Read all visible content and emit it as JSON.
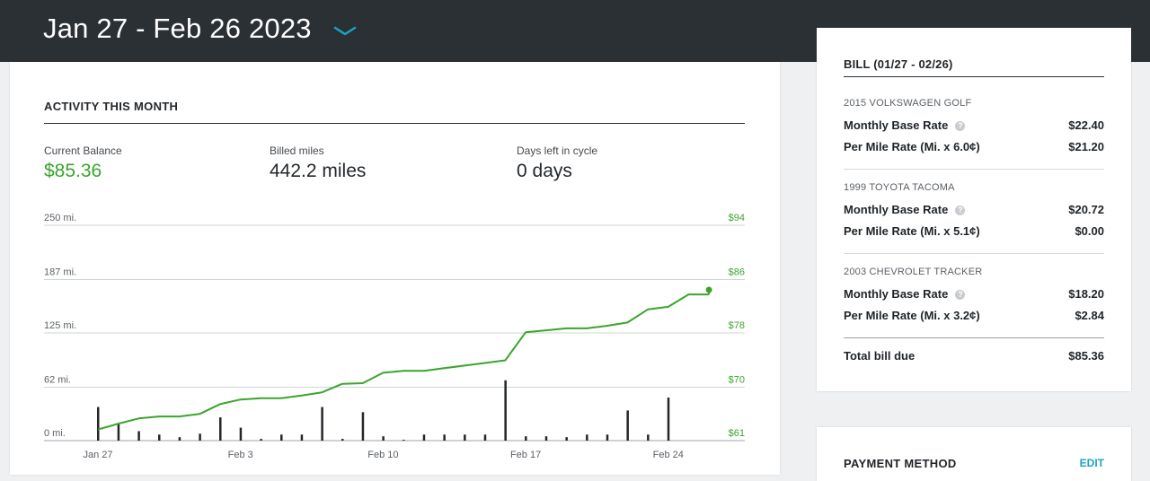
{
  "header": {
    "date_range": "Jan 27 - Feb 26 2023"
  },
  "activity": {
    "title": "ACTIVITY THIS MONTH",
    "stats": [
      {
        "label": "Current Balance",
        "value": "$85.36"
      },
      {
        "label": "Billed miles",
        "value": "442.2 miles"
      },
      {
        "label": "Days left in cycle",
        "value": "0 days"
      }
    ]
  },
  "chart_data": {
    "type": "line",
    "left_axis": {
      "ticks": [
        "250 mi.",
        "187 mi.",
        "125 mi.",
        "62 mi.",
        "0 mi."
      ],
      "values": [
        250,
        187,
        125,
        62,
        0
      ]
    },
    "right_axis": {
      "ticks": [
        "$94",
        "$86",
        "$78",
        "$70",
        "$61"
      ],
      "values": [
        94,
        86,
        78,
        70,
        61
      ]
    },
    "x_ticks": [
      "Jan 27",
      "Feb 3",
      "Feb 10",
      "Feb 17",
      "Feb 24"
    ],
    "days": [
      "2023-01-27",
      "2023-01-28",
      "2023-01-29",
      "2023-01-30",
      "2023-01-31",
      "2023-02-01",
      "2023-02-02",
      "2023-02-03",
      "2023-02-04",
      "2023-02-05",
      "2023-02-06",
      "2023-02-07",
      "2023-02-08",
      "2023-02-09",
      "2023-02-10",
      "2023-02-11",
      "2023-02-12",
      "2023-02-13",
      "2023-02-14",
      "2023-02-15",
      "2023-02-16",
      "2023-02-17",
      "2023-02-18",
      "2023-02-19",
      "2023-02-20",
      "2023-02-21",
      "2023-02-22",
      "2023-02-23",
      "2023-02-24",
      "2023-02-25",
      "2023-02-26"
    ],
    "series": [
      {
        "axis": "left",
        "type": "bar",
        "color": "#23272b",
        "values": [
          39,
          19,
          11,
          7,
          4,
          8,
          27,
          15,
          2,
          7,
          7,
          39,
          2,
          33,
          5,
          1,
          7,
          7,
          7,
          7,
          70,
          5,
          5,
          4,
          7,
          7,
          35,
          7,
          50,
          0,
          0
        ]
      },
      {
        "axis": "right",
        "type": "line",
        "color": "#3aa52c",
        "values": [
          62.7,
          63.6,
          64.4,
          64.7,
          64.7,
          65.1,
          66.6,
          67.3,
          67.5,
          67.5,
          67.9,
          68.4,
          69.7,
          69.8,
          71.4,
          71.7,
          71.7,
          72.1,
          72.5,
          72.9,
          73.3,
          77.6,
          77.9,
          78.2,
          78.2,
          78.6,
          79.1,
          81.1,
          81.5,
          83.4,
          83.4
        ]
      }
    ],
    "end_marker_value": 84.1,
    "grid": true
  },
  "bill": {
    "title": "BILL (01/27 - 02/26)",
    "vehicles": [
      {
        "name": "2015 VOLKSWAGEN GOLF",
        "rows": [
          {
            "label": "Monthly Base Rate",
            "value": "$22.40",
            "help": true
          },
          {
            "label": "Per Mile Rate (Mi. x 6.0¢)",
            "value": "$21.20",
            "help": false
          }
        ]
      },
      {
        "name": "1999 TOYOTA TACOMA",
        "rows": [
          {
            "label": "Monthly Base Rate",
            "value": "$20.72",
            "help": true
          },
          {
            "label": "Per Mile Rate (Mi. x 5.1¢)",
            "value": "$0.00",
            "help": false
          }
        ]
      },
      {
        "name": "2003 CHEVROLET TRACKER",
        "rows": [
          {
            "label": "Monthly Base Rate",
            "value": "$18.20",
            "help": true
          },
          {
            "label": "Per Mile Rate (Mi. x 3.2¢)",
            "value": "$2.84",
            "help": false
          }
        ]
      }
    ],
    "total_label": "Total bill due",
    "total_value": "$85.36",
    "help_glyph": "?"
  },
  "payment": {
    "title": "PAYMENT METHOD",
    "edit_label": "EDIT"
  },
  "colors": {
    "accent_green": "#3aa52c",
    "accent_teal": "#1ba3c6",
    "topbar": "#2b3035"
  }
}
